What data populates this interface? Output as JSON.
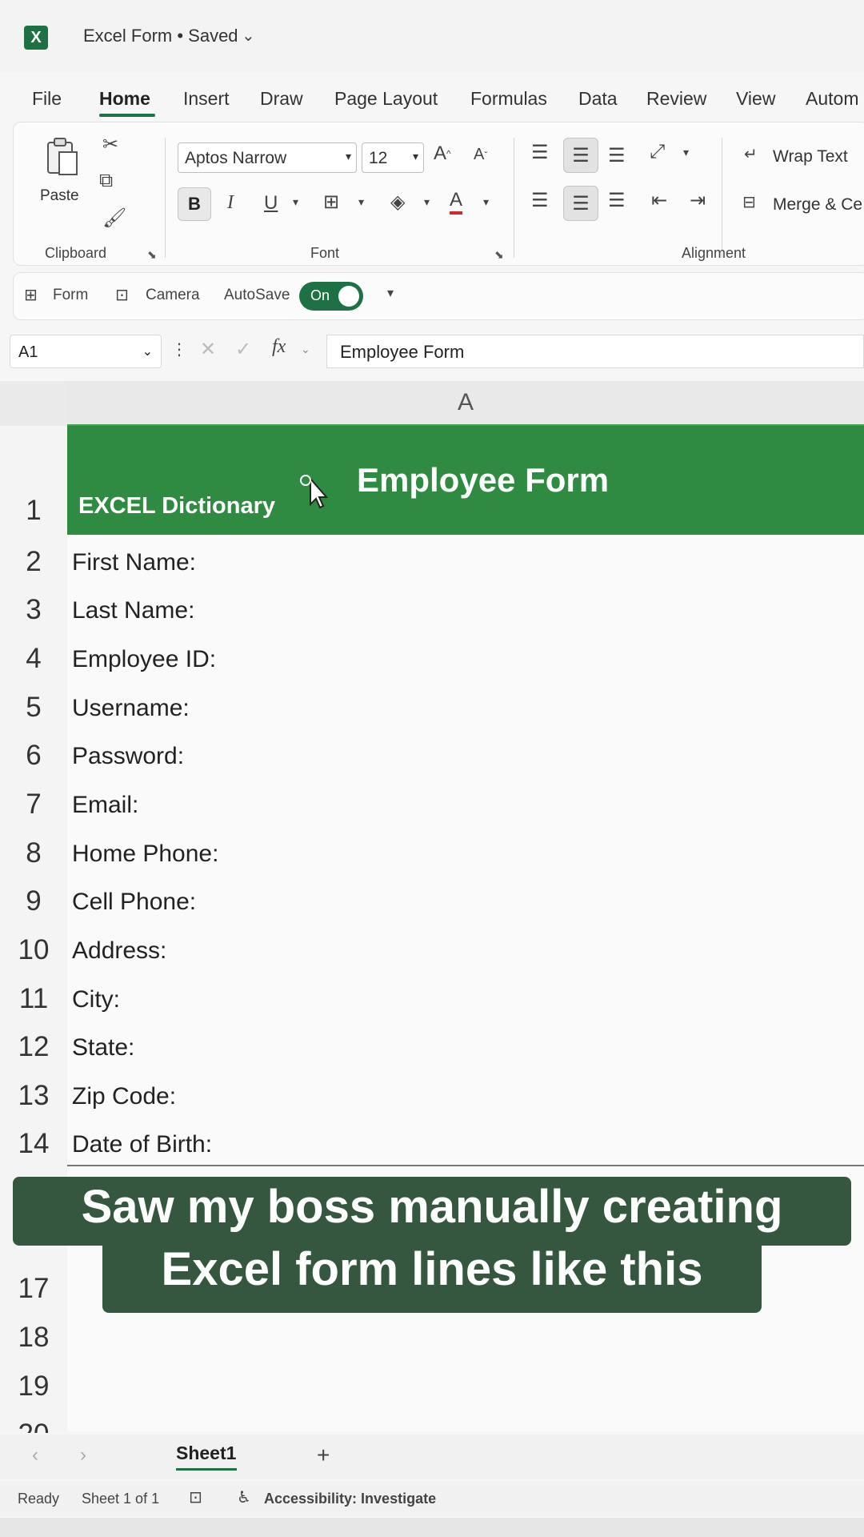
{
  "app": {
    "title": "Excel Form • Saved",
    "logo_letter": "X"
  },
  "menu": [
    "File",
    "Home",
    "Insert",
    "Draw",
    "Page Layout",
    "Formulas",
    "Data",
    "Review",
    "View",
    "Autom"
  ],
  "ribbon": {
    "clipboard": {
      "paste_label": "Paste",
      "group_label": "Clipboard"
    },
    "font": {
      "font_name": "Aptos Narrow",
      "font_size": "12",
      "group_label": "Font",
      "bold": "B",
      "italic": "I",
      "underline": "U"
    },
    "alignment": {
      "wrap_text": "Wrap Text",
      "merge": "Merge & Ce",
      "group_label": "Alignment"
    }
  },
  "qat": {
    "form": "Form",
    "camera": "Camera",
    "autosave": "AutoSave",
    "toggle": "On"
  },
  "formula_bar": {
    "name_box": "A1",
    "fx": "fx",
    "content": "Employee Form"
  },
  "sheet": {
    "column": "A",
    "header_title": "Employee Form",
    "logo_text": "EXCEL Dictionary",
    "rows": [
      {
        "num": "1",
        "label": ""
      },
      {
        "num": "2",
        "label": "First Name:"
      },
      {
        "num": "3",
        "label": "Last Name:"
      },
      {
        "num": "4",
        "label": "Employee ID:"
      },
      {
        "num": "5",
        "label": "Username:"
      },
      {
        "num": "6",
        "label": "Password:"
      },
      {
        "num": "7",
        "label": "Email:"
      },
      {
        "num": "8",
        "label": "Home Phone:"
      },
      {
        "num": "9",
        "label": "Cell Phone:"
      },
      {
        "num": "10",
        "label": "Address:"
      },
      {
        "num": "11",
        "label": "City:"
      },
      {
        "num": "12",
        "label": "State:"
      },
      {
        "num": "13",
        "label": "Zip Code:"
      },
      {
        "num": "14",
        "label": "Date of Birth:"
      },
      {
        "num": "17",
        "label": ""
      },
      {
        "num": "18",
        "label": ""
      },
      {
        "num": "19",
        "label": ""
      },
      {
        "num": "20",
        "label": ""
      }
    ]
  },
  "caption": {
    "line1": "Saw my boss manually creating",
    "line2": "Excel form lines like this"
  },
  "sheet_tabs": {
    "active": "Sheet1",
    "add": "+"
  },
  "status": {
    "ready": "Ready",
    "sheet_of": "Sheet 1 of 1",
    "accessibility": "Accessibility: Investigate"
  }
}
